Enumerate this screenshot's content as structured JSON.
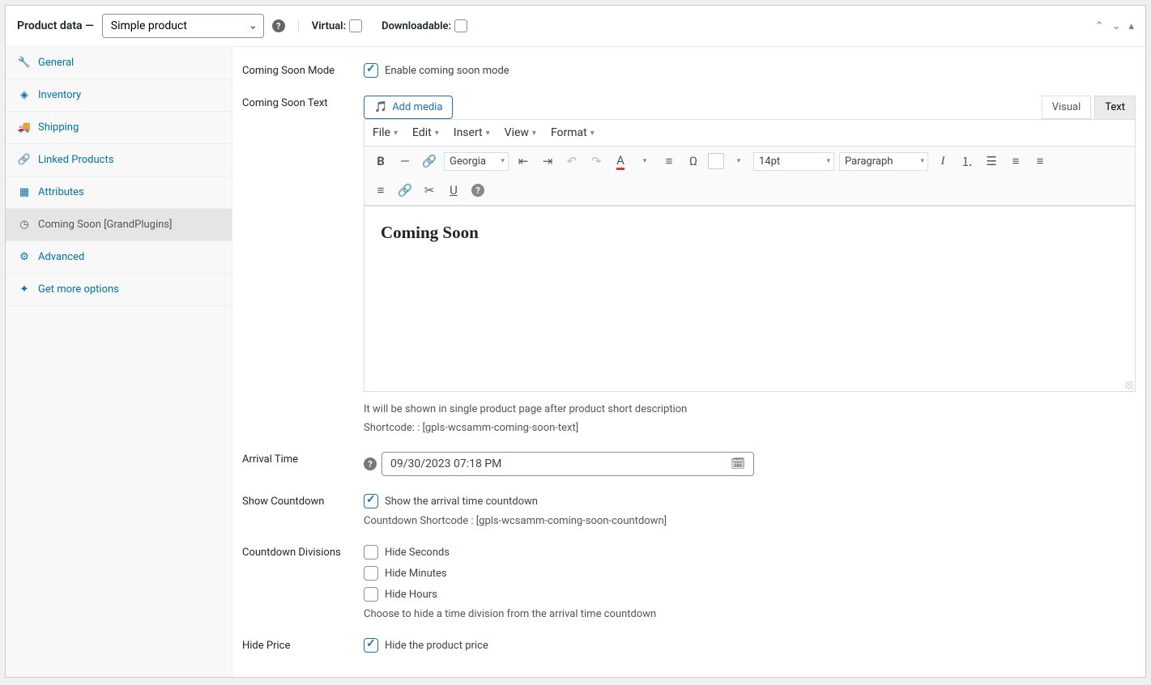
{
  "header": {
    "title": "Product data —",
    "product_type": "Simple product",
    "virtual_label": "Virtual:",
    "downloadable_label": "Downloadable:"
  },
  "sidebar": {
    "items": [
      {
        "label": "General"
      },
      {
        "label": "Inventory"
      },
      {
        "label": "Shipping"
      },
      {
        "label": "Linked Products"
      },
      {
        "label": "Attributes"
      },
      {
        "label": "Coming Soon [GrandPlugins]"
      },
      {
        "label": "Advanced"
      },
      {
        "label": "Get more options"
      }
    ]
  },
  "form": {
    "coming_soon_mode": {
      "label": "Coming Soon Mode",
      "checkbox_label": "Enable coming soon mode"
    },
    "coming_soon_text": {
      "label": "Coming Soon Text",
      "add_media": "Add media",
      "tab_visual": "Visual",
      "tab_text": "Text",
      "menu_file": "File",
      "menu_edit": "Edit",
      "menu_insert": "Insert",
      "menu_view": "View",
      "menu_format": "Format",
      "font_family": "Georgia",
      "font_size": "14pt",
      "paragraph": "Paragraph",
      "content_heading": "Coming Soon",
      "desc1": "It will be shown in single product page after product short description",
      "desc2": "Shortcode: : [gpls-wcsamm-coming-soon-text]"
    },
    "arrival_time": {
      "label": "Arrival Time",
      "value": "09/30/2023 07:18 PM"
    },
    "show_countdown": {
      "label": "Show Countdown",
      "checkbox_label": "Show the arrival time countdown",
      "desc": "Countdown Shortcode : [gpls-wcsamm-coming-soon-countdown]"
    },
    "countdown_divisions": {
      "label": "Countdown Divisions",
      "hide_seconds": "Hide Seconds",
      "hide_minutes": "Hide Minutes",
      "hide_hours": "Hide Hours",
      "desc": "Choose to hide a time division from the arrival time countdown"
    },
    "hide_price": {
      "label": "Hide Price",
      "checkbox_label": "Hide the product price"
    }
  }
}
